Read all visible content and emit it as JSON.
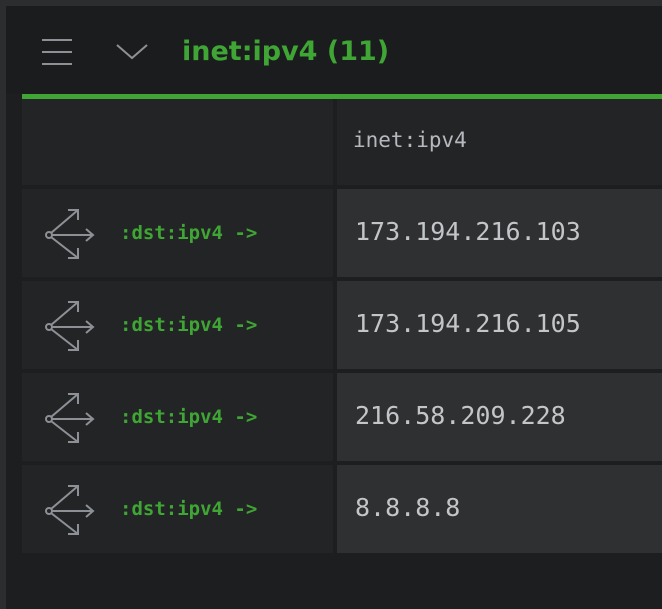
{
  "colors": {
    "accent": "#3fa534",
    "icon": "#8d9196",
    "text": "#c3c6c9",
    "header_text": "#b5b9bd"
  },
  "header": {
    "menu_icon": "hamburger-menu-icon",
    "collapse_icon": "chevron-down-icon",
    "title": "inet:ipv4 (11)"
  },
  "table": {
    "columns": [
      "",
      "inet:ipv4"
    ],
    "rows": [
      {
        "icon": "pivot-icon",
        "pivot": ":dst:ipv4 ->",
        "value": "173.194.216.103"
      },
      {
        "icon": "pivot-icon",
        "pivot": ":dst:ipv4 ->",
        "value": "173.194.216.105"
      },
      {
        "icon": "pivot-icon",
        "pivot": ":dst:ipv4 ->",
        "value": "216.58.209.228"
      },
      {
        "icon": "pivot-icon",
        "pivot": ":dst:ipv4 ->",
        "value": "8.8.8.8"
      }
    ]
  }
}
